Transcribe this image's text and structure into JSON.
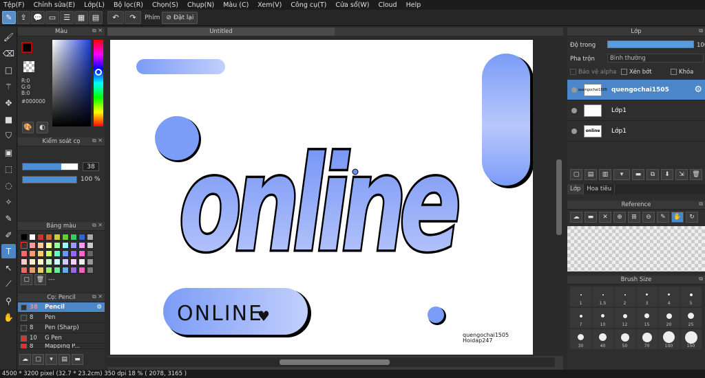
{
  "menu": [
    "Tệp(F)",
    "Chỉnh sửa(E)",
    "Lớp(L)",
    "Bộ lọc(R)",
    "Chọn(S)",
    "Chụp(N)",
    "Màu (C)",
    "Xem(V)",
    "Công cụ(T)",
    "Cửa sổ(W)",
    "Cloud",
    "Help"
  ],
  "toolbar": {
    "phim_label": "Phím",
    "reset_label": "Đặt lại"
  },
  "color_panel": {
    "title": "Màu",
    "r": "R:0",
    "g": "G:0",
    "b": "B:0",
    "hex": "#000000",
    "fg_color": "#000000"
  },
  "brush_control": {
    "title": "Kiểm soát cọ",
    "size": "38",
    "opacity": "100 %"
  },
  "palette": {
    "title": "Bảng màu",
    "name": "---"
  },
  "brush_list": {
    "title": "Cọ: Pencil",
    "items": [
      {
        "size": "38",
        "name": "Pencil",
        "chip": "#333333"
      },
      {
        "size": "8",
        "name": "Pen",
        "chip": "#333333"
      },
      {
        "size": "8",
        "name": "Pen (Sharp)",
        "chip": "#333333"
      },
      {
        "size": "10",
        "name": "G Pen",
        "chip": "#e03030"
      },
      {
        "size": "8",
        "name": "Mapping P...",
        "chip": "#e03030"
      }
    ]
  },
  "document": {
    "tab": "Untitled",
    "artwork": {
      "main_word": "online",
      "pill_text": "ONLINE",
      "signature_line1": "quengochai1505",
      "signature_line2": "Hoidap247"
    }
  },
  "status": "4500 * 3200 pixel   (32.7 * 23.2cm)   350 dpi   18 %   ( 2078, 3165 )",
  "layers": {
    "title": "Lớp",
    "opacity_label": "Độ trong",
    "opacity_value": "100",
    "blend_label": "Pha trộn",
    "blend_value": "Bình thường",
    "protect_alpha": "Bảo vệ alpha",
    "clipping": "Xén bớt",
    "lock": "Khóa",
    "items": [
      {
        "name": "quengochai1505",
        "thumb": "quengochai1505",
        "selected": true
      },
      {
        "name": "Lớp1",
        "thumb": "",
        "selected": false
      },
      {
        "name": "Lớp1",
        "thumb": "online",
        "selected": false
      }
    ]
  },
  "tabs": [
    "Lớp",
    "Hoa tiêu"
  ],
  "reference": {
    "title": "Reference"
  },
  "brush_size": {
    "title": "Brush Size",
    "sizes": [
      "1",
      "1.5",
      "2",
      "3",
      "4",
      "5",
      "7",
      "10",
      "12",
      "15",
      "20",
      "25",
      "30",
      "40",
      "50",
      "70",
      "100",
      "150"
    ]
  },
  "colors": {
    "accent": "#4b86c8",
    "art_blue": "#7b9cf7",
    "art_light": "#b7c6fa"
  }
}
